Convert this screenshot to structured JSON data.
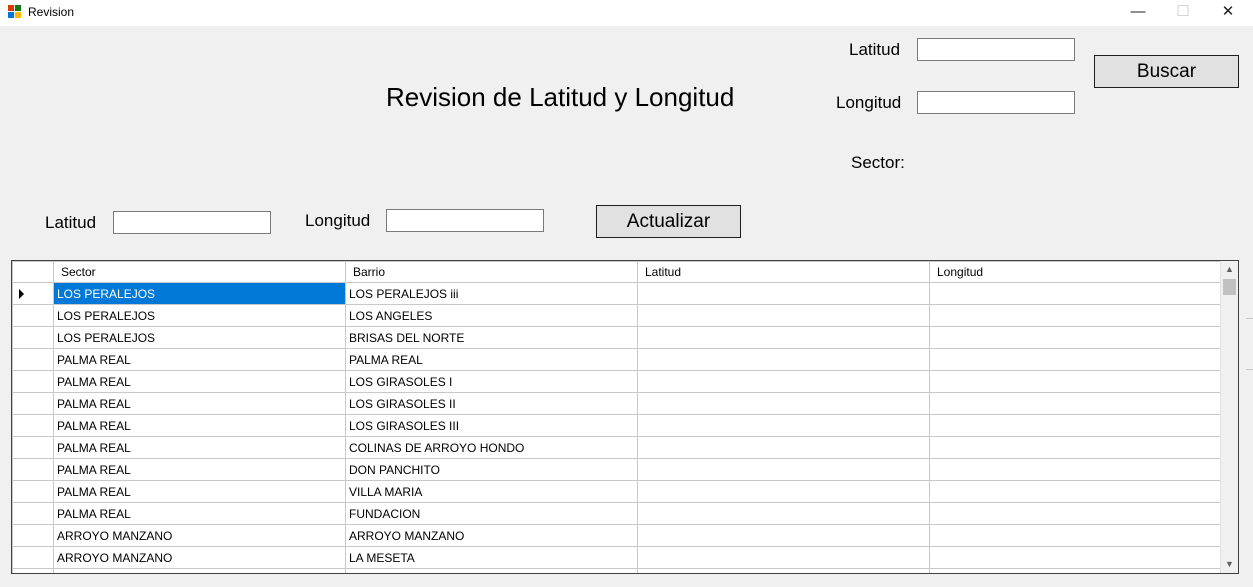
{
  "window": {
    "title": "Revision",
    "minimize_glyph": "—",
    "maximize_glyph": "☐",
    "close_glyph": "✕"
  },
  "heading": "Revision de Latitud y Longitud",
  "search": {
    "latitud_label": "Latitud",
    "latitud_value": "",
    "longitud_label": "Longitud",
    "longitud_value": "",
    "sector_label": "Sector:",
    "buscar_label": "Buscar"
  },
  "update": {
    "latitud_label": "Latitud",
    "latitud_value": "",
    "longitud_label": "Longitud",
    "longitud_value": "",
    "actualizar_label": "Actualizar"
  },
  "grid": {
    "columns": [
      "Sector",
      "Barrio",
      "Latitud",
      "Longitud"
    ],
    "rows": [
      {
        "sector": "LOS PERALEJOS",
        "barrio": "LOS PERALEJOS iii",
        "latitud": "",
        "longitud": ""
      },
      {
        "sector": "LOS PERALEJOS",
        "barrio": "LOS ANGELES",
        "latitud": "",
        "longitud": ""
      },
      {
        "sector": "LOS PERALEJOS",
        "barrio": "BRISAS DEL NORTE",
        "latitud": "",
        "longitud": ""
      },
      {
        "sector": "PALMA REAL",
        "barrio": "PALMA REAL",
        "latitud": "",
        "longitud": ""
      },
      {
        "sector": "PALMA REAL",
        "barrio": "LOS GIRASOLES I",
        "latitud": "",
        "longitud": ""
      },
      {
        "sector": "PALMA REAL",
        "barrio": "LOS GIRASOLES II",
        "latitud": "",
        "longitud": ""
      },
      {
        "sector": "PALMA REAL",
        "barrio": "LOS GIRASOLES III",
        "latitud": "",
        "longitud": ""
      },
      {
        "sector": "PALMA REAL",
        "barrio": "COLINAS DE ARROYO HONDO",
        "latitud": "",
        "longitud": ""
      },
      {
        "sector": "PALMA REAL",
        "barrio": "DON PANCHITO",
        "latitud": "",
        "longitud": ""
      },
      {
        "sector": "PALMA REAL",
        "barrio": "VILLA MARIA",
        "latitud": "",
        "longitud": ""
      },
      {
        "sector": "PALMA REAL",
        "barrio": "FUNDACION",
        "latitud": "",
        "longitud": ""
      },
      {
        "sector": "ARROYO MANZANO",
        "barrio": "ARROYO MANZANO",
        "latitud": "",
        "longitud": ""
      },
      {
        "sector": "ARROYO MANZANO",
        "barrio": "LA MESETA",
        "latitud": "",
        "longitud": ""
      },
      {
        "sector": "",
        "barrio": "",
        "latitud": "",
        "longitud": ""
      }
    ],
    "selected_row": 0
  },
  "colors": {
    "selection": "#0078d7",
    "window_bg": "#f0f0f0"
  },
  "icons": [
    "app-icon",
    "row-selector-arrow-icon",
    "scroll-up-icon",
    "scroll-down-icon"
  ]
}
